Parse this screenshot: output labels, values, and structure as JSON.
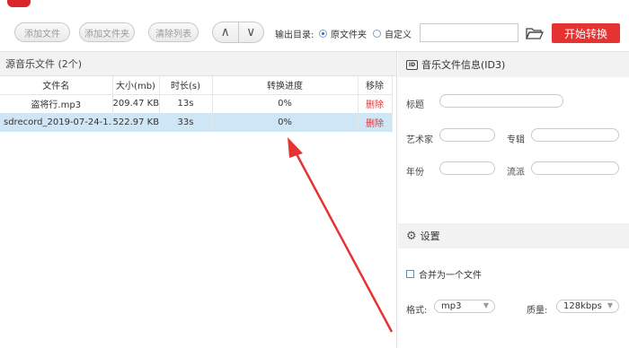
{
  "toolbar": {
    "add_file": "添加文件",
    "add_folder": "添加文件夹",
    "clear_list": "清除列表",
    "up_arrow": "∧",
    "down_arrow": "∨",
    "output_label": "输出目录:",
    "radio_original": "原文件夹",
    "radio_custom": "自定义",
    "output_path": "",
    "start_button": "开始转换"
  },
  "filelist": {
    "title": "源音乐文件 (2个)",
    "columns": [
      "文件名",
      "大小(mb)",
      "时长(s)",
      "转换进度",
      "移除"
    ],
    "rows": [
      {
        "name": "盗将行.mp3",
        "size": "209.47 KB",
        "duration": "13s",
        "progress": "0%",
        "remove": "删除",
        "selected": false
      },
      {
        "name": "sdrecord_2019-07-24-1...",
        "size": "522.97 KB",
        "duration": "33s",
        "progress": "0%",
        "remove": "删除",
        "selected": true
      }
    ]
  },
  "info": {
    "title": "音乐文件信息(ID3)",
    "id_badge": "ID",
    "title_label": "标题",
    "artist_label": "艺术家",
    "album_label": "专辑",
    "year_label": "年份",
    "genre_label": "流派"
  },
  "settings": {
    "title": "设置",
    "merge_label": "合并为一个文件",
    "format_label": "格式:",
    "format_value": "mp3",
    "quality_label": "质量:",
    "quality_value": "128kbps"
  },
  "colors": {
    "accent": "#e53333",
    "selected_row": "#cfe6f7",
    "arrow": "#e53333"
  }
}
